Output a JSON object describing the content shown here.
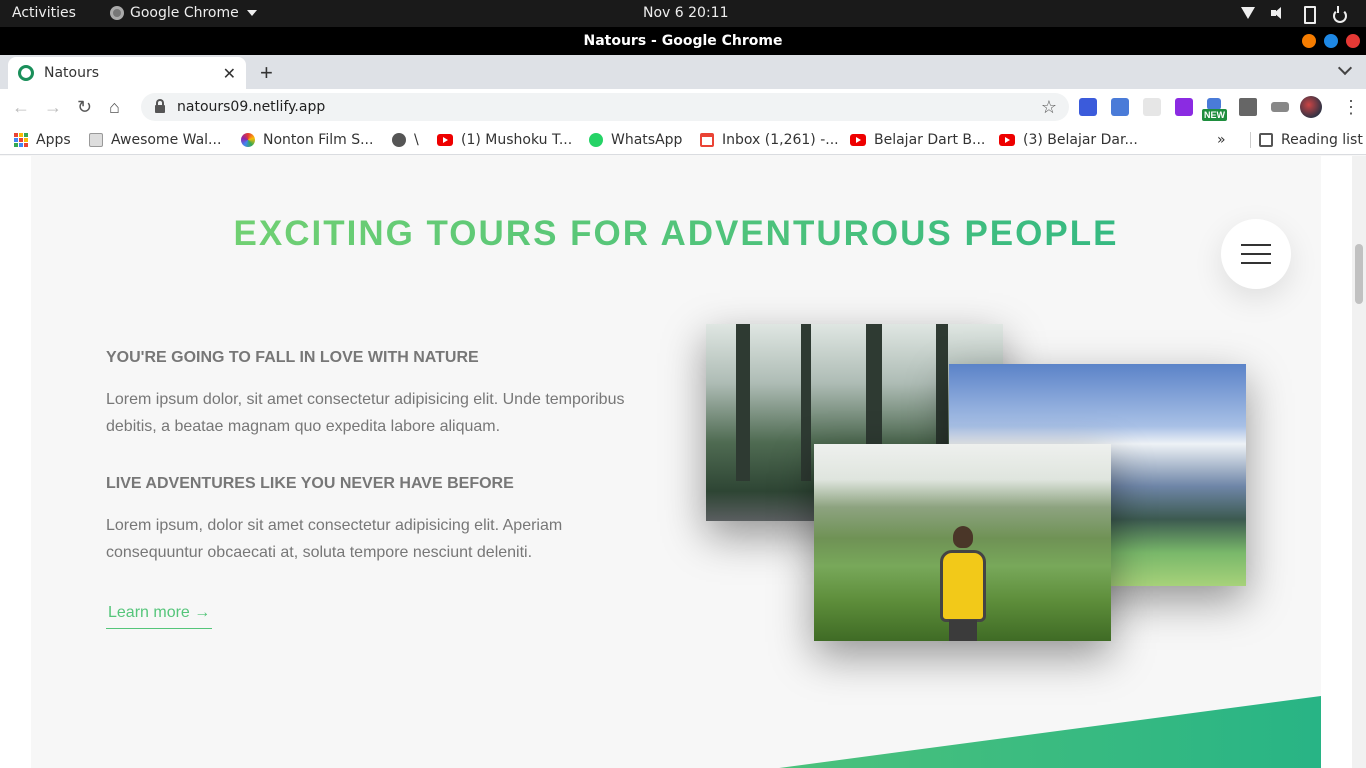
{
  "system_bar": {
    "activities": "Activities",
    "app_menu": "Google Chrome",
    "clock": "Nov 6  20:11"
  },
  "window": {
    "title": "Natours - Google Chrome",
    "buttons": [
      {
        "name": "minimize",
        "color": "#f57c00"
      },
      {
        "name": "maximize",
        "color": "#1e88e5"
      },
      {
        "name": "close",
        "color": "#e53935"
      }
    ]
  },
  "tabs": [
    {
      "label": "Natours",
      "active": true
    }
  ],
  "new_tab_label": "+",
  "address_bar": {
    "url": "natours09.netlify.app"
  },
  "bookmarks": [
    {
      "label": "Apps",
      "icon": "apps-grid-icon"
    },
    {
      "label": "Awesome Wal...",
      "icon": "awesome-icon"
    },
    {
      "label": "Nonton Film S...",
      "icon": "flower-icon"
    },
    {
      "label": "\\",
      "icon": "globe-icon"
    },
    {
      "label": "(1) Mushoku T...",
      "icon": "youtube-icon"
    },
    {
      "label": "WhatsApp",
      "icon": "whatsapp-icon"
    },
    {
      "label": "Inbox (1,261) -...",
      "icon": "gmail-icon"
    },
    {
      "label": "Belajar Dart B...",
      "icon": "youtube-icon"
    },
    {
      "label": "(3) Belajar Dar...",
      "icon": "youtube-icon"
    }
  ],
  "bookmarks_overflow": "»",
  "reading_list": "Reading list",
  "extensions_new_badge": "NEW",
  "page": {
    "heading": "EXCITING TOURS FOR ADVENTUROUS PEOPLE",
    "features": [
      {
        "title": "YOU'RE GOING TO FALL IN LOVE WITH NATURE",
        "text": "Lorem ipsum dolor, sit amet consectetur adipisicing elit. Unde temporibus debitis, a beatae magnam quo expedita labore aliquam."
      },
      {
        "title": "LIVE ADVENTURES LIKE YOU NEVER HAVE BEFORE",
        "text": "Lorem ipsum, dolor sit amet consectetur adipisicing elit. Aperiam consequuntur obcaecati at, soluta tempore nesciunt deleniti."
      }
    ],
    "cta": "Learn more →",
    "accent_colors": {
      "light": "#7ed56f",
      "dark": "#28b485"
    }
  }
}
